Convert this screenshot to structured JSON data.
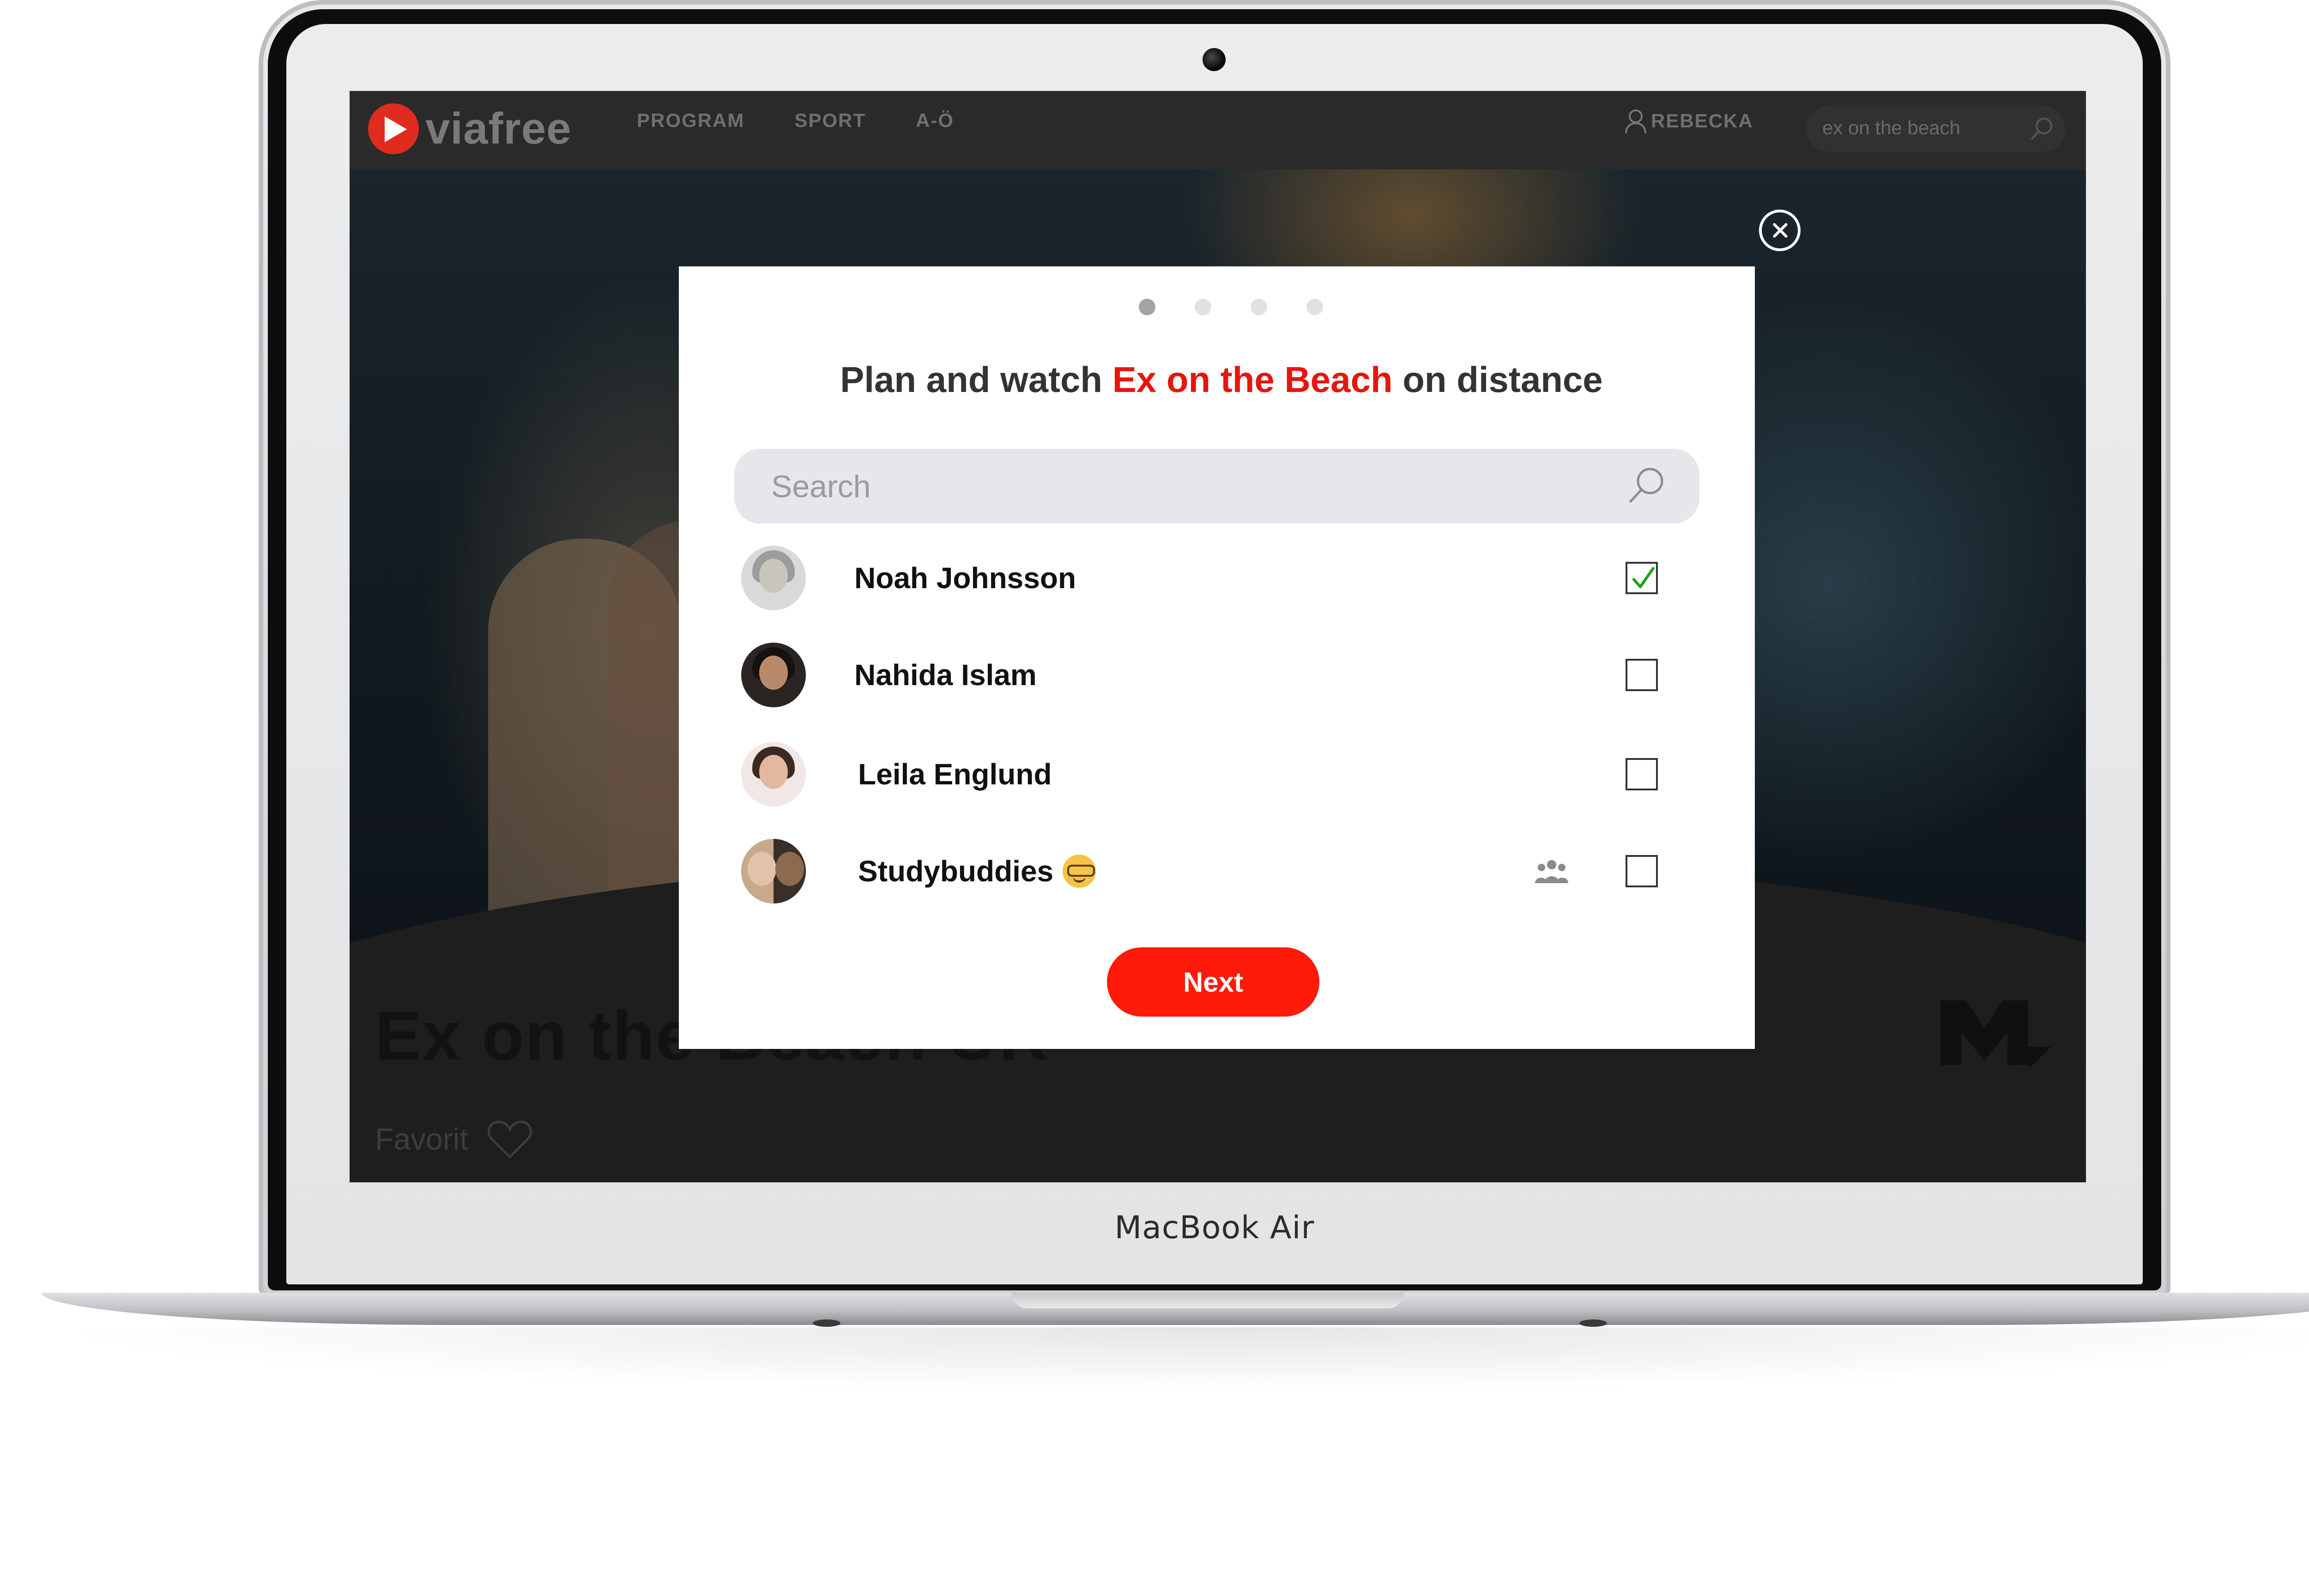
{
  "device": {
    "brand_label": "MacBook Air"
  },
  "site": {
    "logo_text": "viafree",
    "nav": [
      "PROGRAM",
      "SPORT",
      "A-Ö"
    ],
    "user_name": "REBECKA",
    "search_value": "ex on the beach",
    "accent_color": "#e8150d"
  },
  "page": {
    "show_title": "Ex on the Beach UK",
    "favorite_label": "Favorit",
    "channel_logo": "MTV"
  },
  "modal": {
    "step_count": 4,
    "active_step": 1,
    "title_prefix": "Plan and watch ",
    "title_highlight": "Ex on the Beach",
    "title_suffix": " on distance",
    "search_placeholder": "Search",
    "contacts": [
      {
        "name": "Noah Johnsson",
        "checked": true,
        "is_group": false
      },
      {
        "name": "Nahida Islam",
        "checked": false,
        "is_group": false
      },
      {
        "name": "Leila Englund",
        "checked": false,
        "is_group": false
      },
      {
        "name": "Studybuddies",
        "checked": false,
        "is_group": true,
        "emoji": "nerd-face-icon"
      }
    ],
    "next_label": "Next"
  }
}
